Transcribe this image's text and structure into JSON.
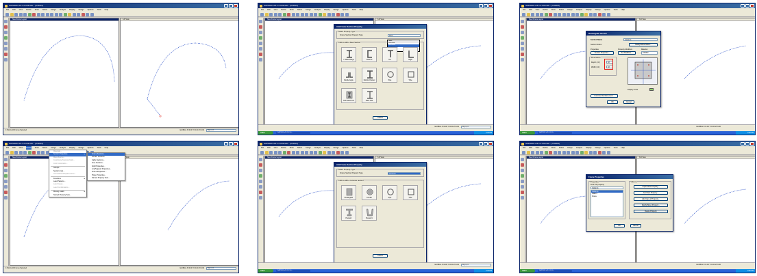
{
  "app": {
    "window_title": "SAP2000 v15.1.0 Ultimate - (Untitled)",
    "menus": [
      "File",
      "Edit",
      "View",
      "Define",
      "Draw",
      "Select",
      "Assign",
      "Analyze",
      "Display",
      "Design",
      "Options",
      "Tools",
      "Help"
    ],
    "view_left_title": "Steel Frame Layout",
    "view_right_title": "3-D View",
    "start_label": "start",
    "taskbar_item": "SAP2000 v15.1.0 Ult...",
    "tray_time": "2:46 PM"
  },
  "panel1": {
    "status_text": "4 Points 100 Lines Selected",
    "coords": "GLOBAL  X=0.00  Y=0.00  Z=3.00",
    "units": "Kip, in, F"
  },
  "panel2": {
    "dialog_title": "Add Frame Section Property",
    "group_select_label": "Select Property Type",
    "frame_section_type_label": "Frame Section Property Type",
    "frame_section_type_value": "Steel",
    "type_options": [
      "Steel",
      "Concrete",
      "Aluminum",
      "Cold Formed",
      "Other"
    ],
    "group_click_label": "Click to Add a Steel Section",
    "tiles": [
      "I / Wide Flange",
      "Channel",
      "Tee",
      "Angle",
      "Double Angle",
      "Double Channel",
      "Pipe",
      "Tube",
      "Auto Select List",
      "Steel Joist"
    ],
    "cancel_label": "Cancel",
    "coords": "GLOBAL  X=0.00  Y=0.00  Z=3.00",
    "units": "Kip, in, F"
  },
  "panel3": {
    "dialog_title": "Rectangular Section",
    "section_name_label": "Section Name",
    "section_name_value": "Column1",
    "section_notes_label": "Section Notes",
    "modify_notes_label": "Modify/Show Notes...",
    "properties_label": "Properties",
    "section_properties_btn": "Section Properties...",
    "property_modifiers_label": "Property Modifiers",
    "set_modifiers_btn": "Set Modifiers...",
    "material_label": "Material",
    "material_value": "4000Psi",
    "dimensions_label": "Dimensions",
    "depth_label": "Depth ( t3 )",
    "depth_value": "18",
    "width_label": "Width ( t2 )",
    "width_value": "18",
    "display_color_label": "Display Color",
    "concrete_reinf_btn": "Concrete Reinforcement...",
    "ok_label": "OK",
    "cancel_label": "Cancel",
    "coords": "GLOBAL  X=0.00  Y=0.00  Z=3.00"
  },
  "panel4": {
    "status_text": "4 Points 100 Lines Selected",
    "coords": "GLOBAL  X=0.00  Y=0.00  Z=3.00",
    "units": "Kip, in, F",
    "define_menu": [
      "Materials...",
      "Section Properties",
      "Mass Source...",
      "Coordinate Systems/Grids...",
      "Joint Constraints...",
      "Groups...",
      "Section Cuts...",
      "Generalized Displacements...",
      "Functions",
      "Load Patterns...",
      "Load Cases...",
      "Load Combinations...",
      "Moving Loads",
      "Named Property Sets..."
    ],
    "section_submenu": [
      "Frame Sections...",
      "Tendon Sections...",
      "Cable Sections...",
      "Area Sections...",
      "Solid Properties...",
      "Link/Support Properties...",
      "Frame Properties...",
      "Hinge Properties...",
      "Named Property Sets..."
    ]
  },
  "panel5": {
    "dialog_title": "Add Frame Section Property",
    "group_select_label": "Select Property Type",
    "frame_section_type_label": "Frame Section Property Type",
    "frame_section_type_value": "Concrete",
    "group_click_label": "Click to Add a Concrete Section",
    "tiles": [
      "Rectangular",
      "Circular",
      "Pipe",
      "Tube",
      "Precast I",
      "Precast U"
    ],
    "cancel_label": "Cancel",
    "coords": "GLOBAL  X=0.00  Y=0.00  Z=3.00",
    "units": "Kip, in, F"
  },
  "panel6": {
    "dialog_title": "Frame Properties",
    "properties_label": "Properties",
    "find_label": "Find this property",
    "find_value": "Column1",
    "list_items": [
      "Column1",
      "FSEC1",
      "Frame"
    ],
    "click_to_label": "Click to:",
    "btn_import": "Import New Property...",
    "btn_add": "Add New Property...",
    "btn_copy": "Add Copy of Property...",
    "btn_modify": "Modify/Show Property...",
    "btn_delete": "Delete Property",
    "ok_label": "OK",
    "cancel_label": "Cancel",
    "coords": "GLOBAL  X=0.00  Y=0.00  Z=3.00"
  },
  "colors": {
    "title_blue": "#0a246a",
    "xp_taskbar": "#245edb",
    "start_green": "#3c9a3c",
    "arch_blue": "#2a50c8",
    "highlight": "#e0201a"
  }
}
